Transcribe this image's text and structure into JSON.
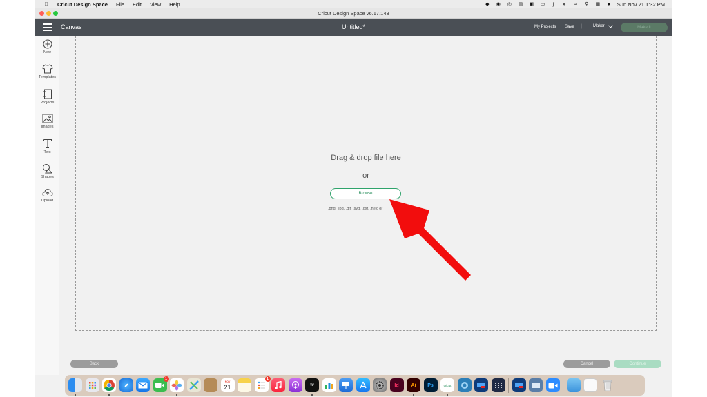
{
  "menubar": {
    "app_name": "Cricut Design Space",
    "menus": [
      "File",
      "Edit",
      "View",
      "Help"
    ],
    "clock": "Sun Nov 21  1:32 PM"
  },
  "window": {
    "title": "Cricut Design Space  v6.17.143"
  },
  "header": {
    "section": "Canvas",
    "document_title": "Untitled*",
    "my_projects": "My Projects",
    "save": "Save",
    "separator": "|",
    "machine": "Maker",
    "make_it": "Make It"
  },
  "sidebar": {
    "items": [
      {
        "label": "New",
        "icon": "plus-circle-icon"
      },
      {
        "label": "Templates",
        "icon": "tshirt-icon"
      },
      {
        "label": "Projects",
        "icon": "notebook-icon"
      },
      {
        "label": "Images",
        "icon": "image-icon"
      },
      {
        "label": "Text",
        "icon": "text-t-icon"
      },
      {
        "label": "Shapes",
        "icon": "shapes-icon"
      },
      {
        "label": "Upload",
        "icon": "cloud-upload-icon"
      }
    ]
  },
  "upload": {
    "drop_title": "Drag & drop file here",
    "or": "or",
    "browse": "Browse",
    "file_types": ".png, .jpg, .gif, .svg, .dxf, .heic or"
  },
  "footer": {
    "back": "Back",
    "cancel": "Cancel",
    "continue": "Continue"
  },
  "dock": {
    "calendar_month": "NOV",
    "calendar_day": "21",
    "facetime_badge": "1",
    "reminders_badge": "1",
    "labels": {
      "appletv": "tv",
      "indesign": "Id",
      "illustrator": "Ai",
      "photoshop": "Ps",
      "cricut": "cricut"
    }
  },
  "colors": {
    "header": "#4a4f55",
    "accent_green": "#2fa36b",
    "arrow_red": "#f20d0d"
  }
}
